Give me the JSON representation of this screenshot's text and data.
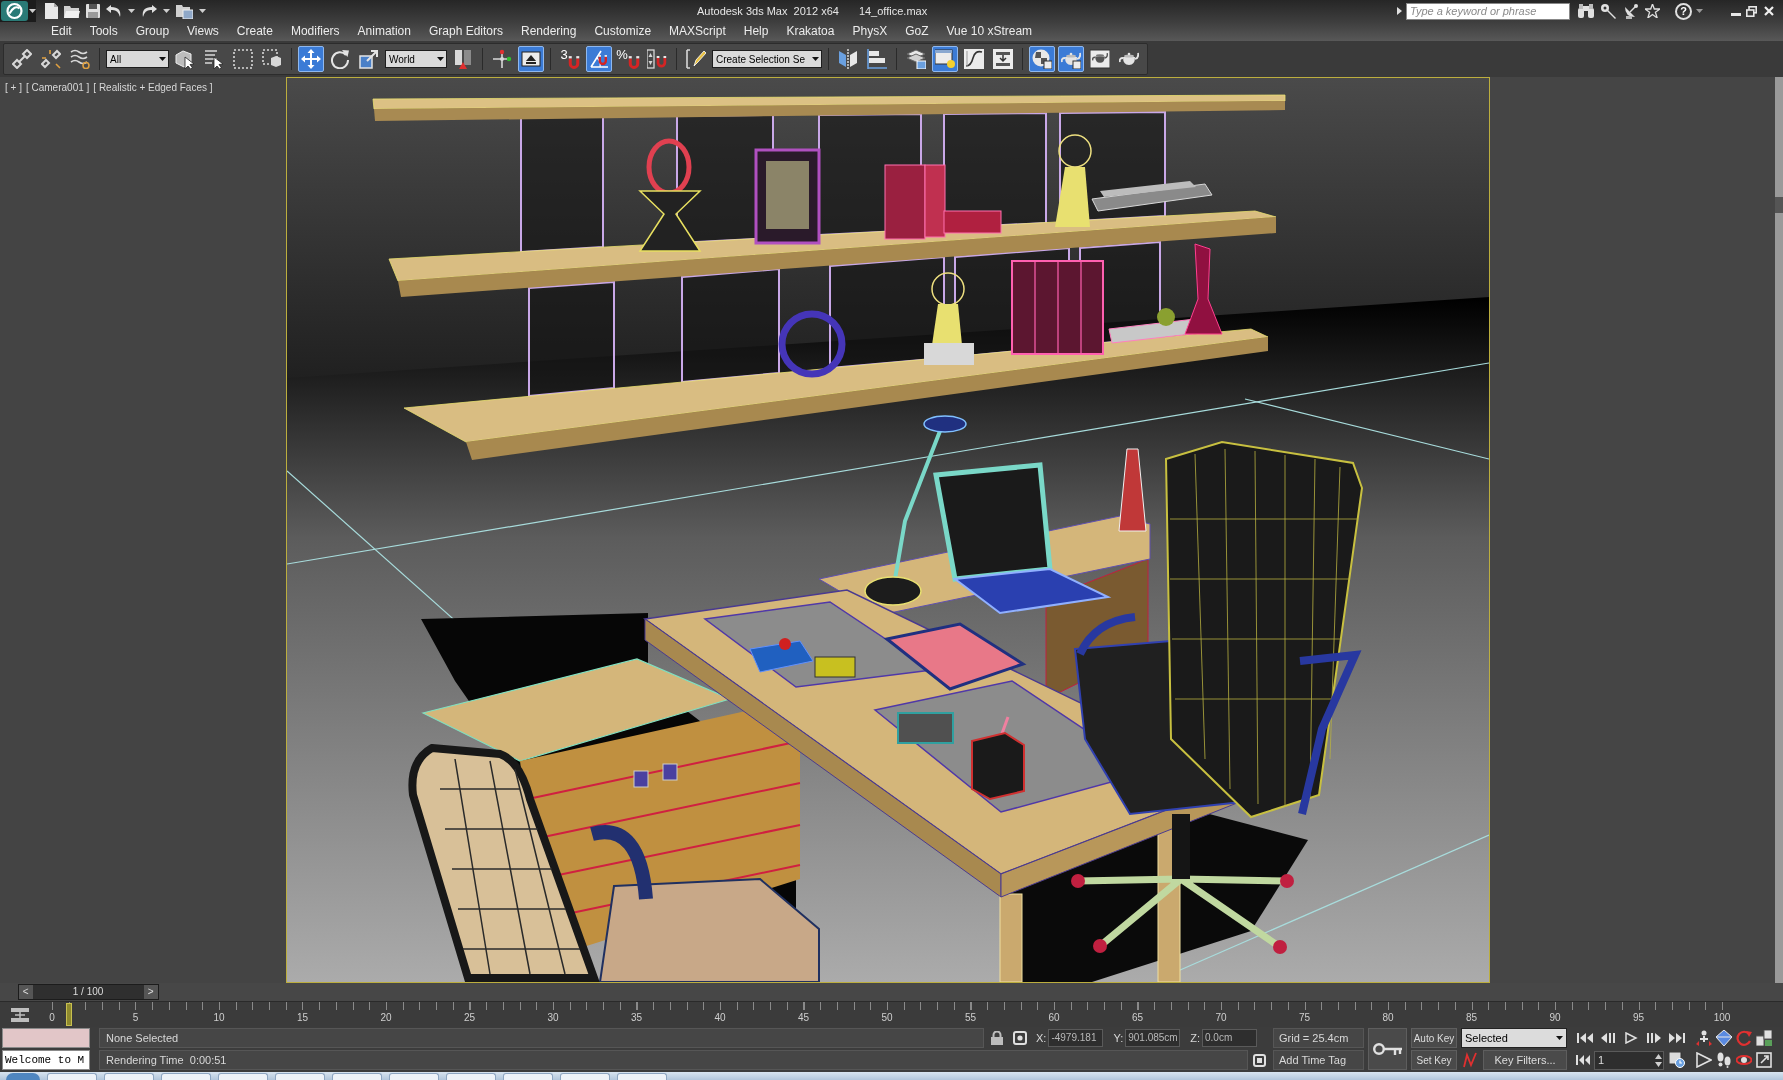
{
  "title_bar": {
    "title": "Autodesk 3ds Max  2012 x64",
    "file": "14_office.max",
    "search": {
      "placeholder": "Type a keyword or phrase"
    },
    "help": "?"
  },
  "menu_bar": [
    "Edit",
    "Tools",
    "Group",
    "Views",
    "Create",
    "Modifiers",
    "Animation",
    "Graph Editors",
    "Rendering",
    "Customize",
    "MAXScript",
    "Help",
    "Krakatoa",
    "PhysX",
    "GoZ",
    "Vue 10 xStream"
  ],
  "main_toolbar": {
    "groups": [
      [
        {
          "kind": "button",
          "on": false
        },
        {
          "kind": "button",
          "on": false
        },
        {
          "kind": "button",
          "on": false
        }
      ],
      [
        {
          "kind": "dropdown",
          "value": "All"
        },
        {
          "kind": "button",
          "on": false
        },
        {
          "kind": "button",
          "on": false
        },
        {
          "kind": "button",
          "on": false
        },
        {
          "kind": "button",
          "on": false
        }
      ],
      [
        {
          "kind": "button",
          "on": true
        },
        {
          "kind": "button",
          "on": false
        },
        {
          "kind": "button",
          "on": false
        },
        {
          "kind": "dropdown",
          "value": "World"
        },
        {
          "kind": "button",
          "on": false
        }
      ],
      [
        {
          "kind": "button",
          "on": false
        },
        {
          "kind": "button",
          "on": true
        }
      ],
      [
        {
          "kind": "button",
          "label": "3",
          "on": false
        },
        {
          "kind": "button",
          "on": true
        },
        {
          "kind": "button",
          "label": "%",
          "on": false
        },
        {
          "kind": "button",
          "on": false
        }
      ],
      [
        {
          "kind": "button",
          "on": false
        },
        {
          "kind": "dropdown",
          "value": "Create Selection Se"
        }
      ],
      [
        {
          "kind": "button",
          "on": false
        },
        {
          "kind": "button",
          "on": false
        }
      ],
      [
        {
          "kind": "button",
          "on": false
        },
        {
          "kind": "button",
          "on": true
        },
        {
          "kind": "button",
          "on": false
        },
        {
          "kind": "button",
          "on": false
        }
      ],
      [
        {
          "kind": "button",
          "on": true
        },
        {
          "kind": "button",
          "on": true
        },
        {
          "kind": "button",
          "on": false
        },
        {
          "kind": "button",
          "on": false
        }
      ]
    ]
  },
  "viewport": {
    "labels": [
      "[ + ]",
      "[ Camera001 ]",
      "[ Realistic + Edged Faces ]"
    ]
  },
  "time_slider": {
    "prev": "<",
    "label": "1 / 100",
    "next": ">",
    "level": 0.01
  },
  "track_bar": {
    "labels": [
      "0",
      "5",
      "10",
      "15",
      "20",
      "25",
      "30",
      "35",
      "40",
      "45",
      "50",
      "55",
      "60",
      "65",
      "70",
      "75",
      "80",
      "85",
      "90",
      "95",
      "100"
    ]
  },
  "status_bar": {
    "listener_output": "Welcome to M",
    "prompt": "None Selected",
    "info": "Rendering Time  0:00:51",
    "coordinates": [
      {
        "axis": "X:",
        "value": "-4979.181"
      },
      {
        "axis": "Y:",
        "value": "901.085cm"
      },
      {
        "axis": "Z:",
        "value": "0.0cm"
      }
    ],
    "grid": "Grid = 25.4cm",
    "time_tag": "Add Time Tag",
    "auto_key": {
      "label": "Auto Key",
      "on": false
    },
    "set_key": "Set Key",
    "key_filter_set": "Selected",
    "key_filters": "Key Filters...",
    "current_frame": "1"
  }
}
